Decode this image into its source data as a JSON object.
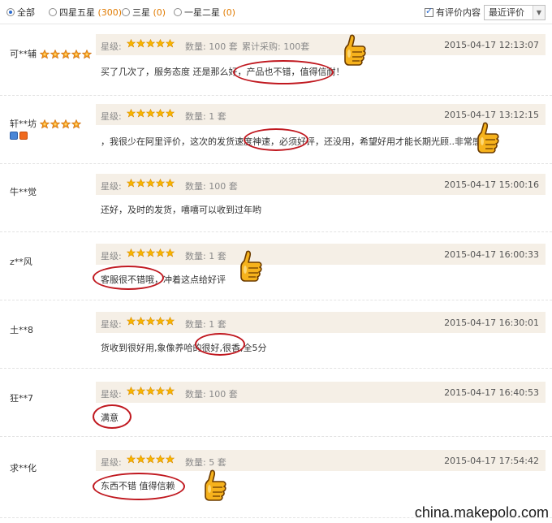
{
  "filters": {
    "all": "全部",
    "four_five": "四星五星",
    "four_five_count": "(300)",
    "three": "三星",
    "three_count": "(0)",
    "one_two": "一星二星",
    "one_two_count": "(0)",
    "has_content": "有评价内容",
    "sort_selected": "最近评价"
  },
  "icons": {
    "star": "star-icon",
    "medal": "medal-icon",
    "thumb": "thumbs-up-icon",
    "arrow": "chevron-down-icon"
  },
  "colors": {
    "meta_bg": "#f5efe6",
    "circle": "#c0181f",
    "count": "#e07a00"
  },
  "labels": {
    "rating": "星级:",
    "qty_prefix": "数量:"
  },
  "reviews": [
    {
      "user": "可**辅",
      "rating": 5,
      "qty": "数量: 100 套",
      "cumulative": "累计采购: 100套",
      "time": "2015-04-17 12:13:07",
      "text": "买了几次了，服务态度 还是那么好，产品也不错，值得信耐！"
    },
    {
      "user": "轩**坊",
      "rating": 5,
      "qty": "数量: 1 套",
      "time": "2015-04-17 13:12:15",
      "text": "，我很少在阿里评价，这次的发货速度神速，必须好评，还没用，希望好用才能长期光顾..非常感谢"
    },
    {
      "user": "牛**觉",
      "rating": 5,
      "qty": "数量: 100 套",
      "time": "2015-04-17 15:00:16",
      "text": "还好，及时的发货，嘻嘻可以收到过年哟"
    },
    {
      "user": "z**风",
      "rating": 5,
      "qty": "数量: 1 套",
      "time": "2015-04-17 16:00:33",
      "text": "客服很不错哦，冲着这点给好评"
    },
    {
      "user": "土**8",
      "rating": 5,
      "qty": "数量: 1 套",
      "time": "2015-04-17 16:30:01",
      "text": "货收到很好用,象像养哈的很好,很香,全5分"
    },
    {
      "user": "狂**7",
      "rating": 5,
      "qty": "数量: 100 套",
      "time": "2015-04-17 16:40:53",
      "text": "满意"
    },
    {
      "user": "求**化",
      "rating": 5,
      "qty": "数量: 5 套",
      "time": "2015-04-17 17:54:42",
      "text": "东西不错 值得信赖"
    }
  ],
  "watermark": "china.makepolo.com"
}
